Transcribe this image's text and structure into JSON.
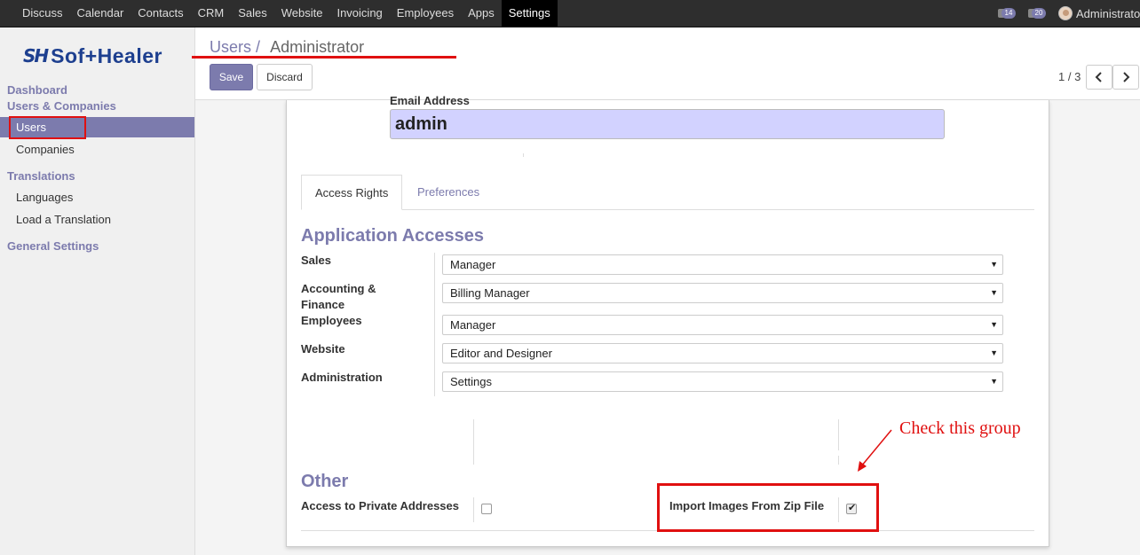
{
  "topbar": {
    "menu": [
      "Discuss",
      "Calendar",
      "Contacts",
      "CRM",
      "Sales",
      "Website",
      "Invoicing",
      "Employees",
      "Apps",
      "Settings"
    ],
    "active": "Settings",
    "messages_count": "14",
    "chat_count": "20",
    "user_name": "Administrator"
  },
  "sidebar": {
    "logo": {
      "mark": "SH",
      "word": "Sof+Healer"
    },
    "sections": [
      {
        "label": "Dashboard"
      },
      {
        "label": "Users & Companies",
        "items": [
          "Users",
          "Companies"
        ]
      },
      {
        "label": "Translations",
        "items": [
          "Languages",
          "Load a Translation"
        ]
      },
      {
        "label": "General Settings"
      }
    ]
  },
  "control": {
    "breadcrumb_parent": "Users",
    "breadcrumb_sep": "/",
    "breadcrumb_current": "Administrator",
    "save_label": "Save",
    "discard_label": "Discard",
    "pager": "1 / 3"
  },
  "form": {
    "email_label": "Email Address",
    "email_value": "admin",
    "tabs": [
      "Access Rights",
      "Preferences"
    ],
    "active_tab": "Access Rights",
    "app_access_title": "Application Accesses",
    "app_access": [
      {
        "label": "Sales",
        "value": "Manager"
      },
      {
        "label": "Accounting & Finance",
        "value": "Billing Manager"
      },
      {
        "label": "Employees",
        "value": "Manager"
      },
      {
        "label": "Website",
        "value": "Editor and Designer"
      },
      {
        "label": "Administration",
        "value": "Settings"
      }
    ],
    "other_title": "Other",
    "other": [
      {
        "label": "Access to Private Addresses",
        "checked": false
      },
      {
        "label": "Import Images From Zip File",
        "checked": true
      }
    ]
  },
  "annotation": {
    "note": "Check this group",
    "color": "#e01010"
  },
  "colors": {
    "accent": "#7c7bad",
    "topbar": "#2e2e2e",
    "email_bg": "#d2d2ff"
  }
}
